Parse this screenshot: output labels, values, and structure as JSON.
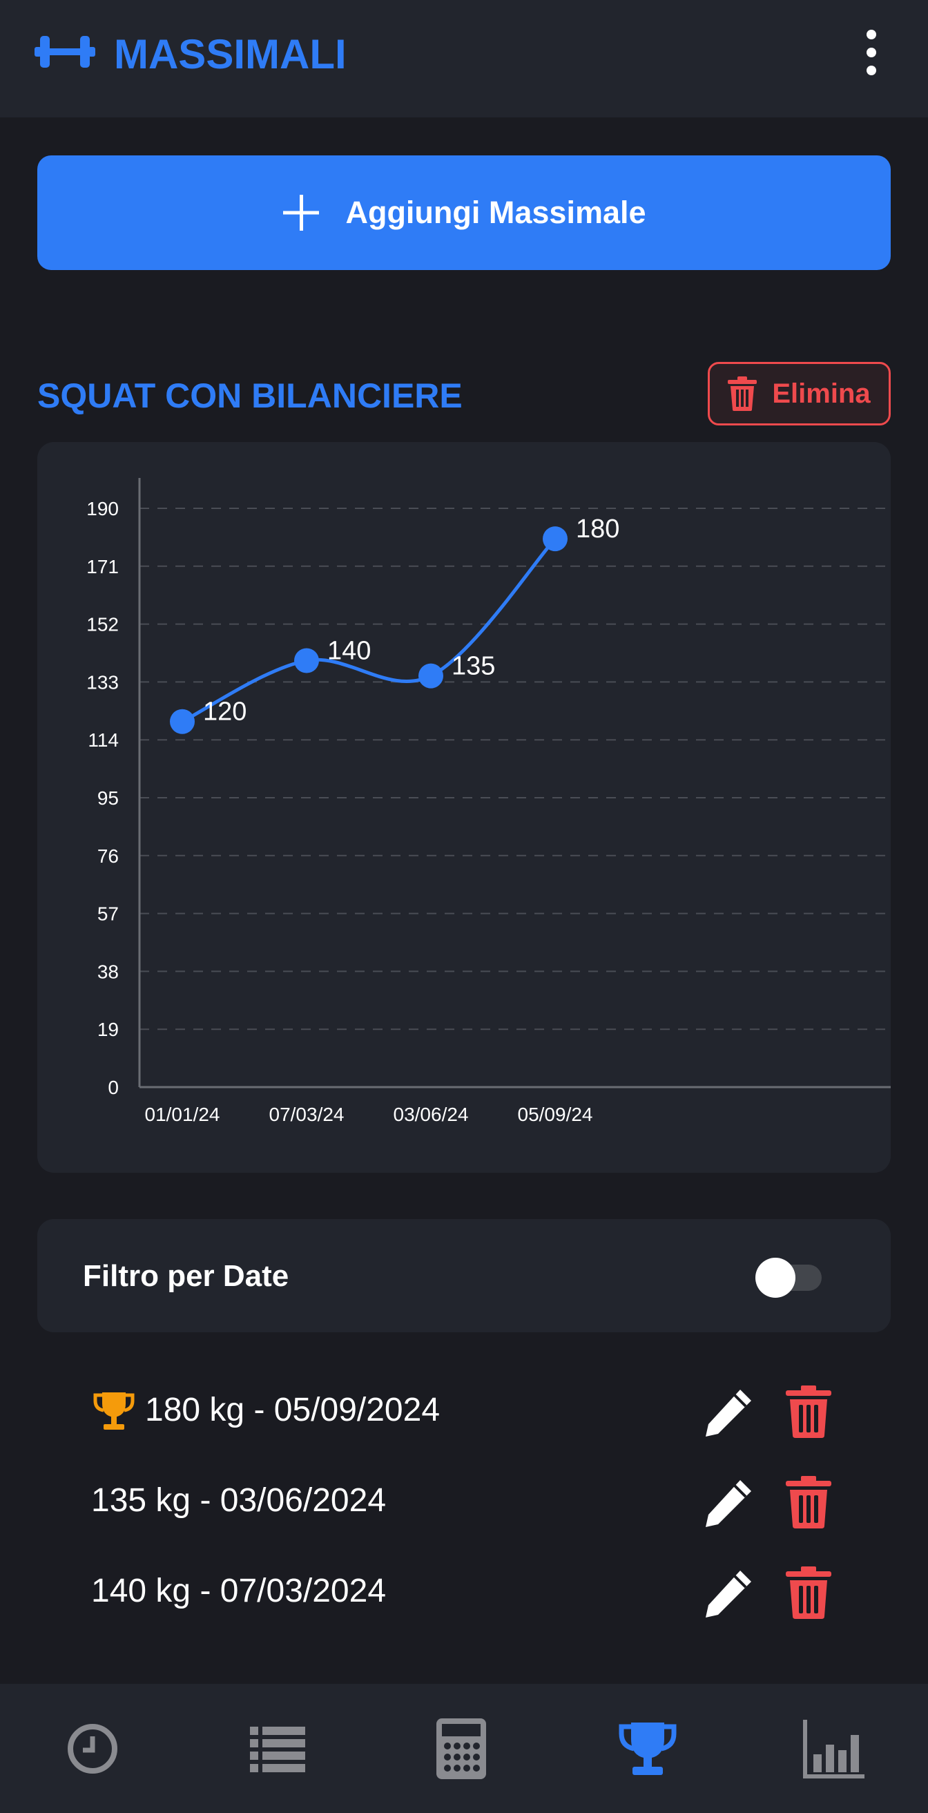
{
  "header": {
    "title": "MASSIMALI",
    "logo_icon": "dumbbell-icon",
    "menu_icon": "more-vert-icon"
  },
  "add_button": {
    "label": "Aggiungi Massimale",
    "icon": "plus-icon"
  },
  "exercise": {
    "title": "SQUAT CON BILANCIERE",
    "delete_label": "Elimina",
    "delete_icon": "trash-icon"
  },
  "chart_data": {
    "type": "line",
    "x": [
      "01/01/24",
      "07/03/24",
      "03/06/24",
      "05/09/24"
    ],
    "y": [
      120,
      140,
      135,
      180
    ],
    "data_labels": [
      "120",
      "140",
      "135",
      "180"
    ],
    "ylim": [
      0,
      190
    ],
    "y_ticks": [
      "0",
      "19",
      "38",
      "57",
      "76",
      "95",
      "114",
      "133",
      "152",
      "171",
      "190"
    ],
    "grid": true,
    "line_color": "#2f7cf6"
  },
  "filter": {
    "label": "Filtro per Date",
    "enabled": false
  },
  "records": [
    {
      "text": "180 kg - 05/09/2024",
      "best": true
    },
    {
      "text": "135 kg - 03/06/2024",
      "best": false
    },
    {
      "text": "140 kg - 07/03/2024",
      "best": false
    }
  ],
  "nav": {
    "items": [
      "history-icon",
      "list-icon",
      "calculator-icon",
      "trophy-icon",
      "bar-chart-icon"
    ],
    "active_index": 3
  },
  "colors": {
    "accent": "#2f7cf6",
    "danger": "#ef4a4d",
    "trophy": "#f59b0b",
    "background": "#1a1b21",
    "surface": "#22252d"
  }
}
